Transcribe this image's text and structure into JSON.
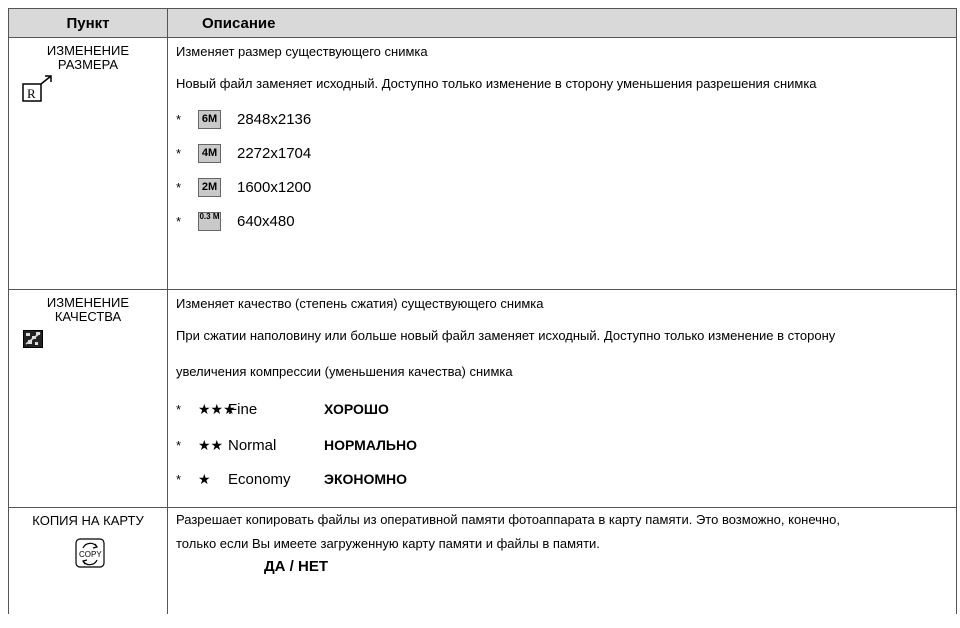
{
  "header": {
    "item": "Пункт",
    "description": "Описание"
  },
  "rows": [
    {
      "item": "ИЗМЕНЕНИЕ РАЗМЕРА",
      "lines": [
        "Изменяет размер существующего снимка",
        "Новый файл заменяет исходный. Доступно только изменение в сторону уменьшения разрешения снимка"
      ],
      "options": [
        {
          "bullet": "*",
          "badge": "6M",
          "value": "2848x2136"
        },
        {
          "bullet": "*",
          "badge": "4M",
          "value": "2272x1704"
        },
        {
          "bullet": "*",
          "badge": "2M",
          "value": "1600x1200"
        },
        {
          "bullet": "*",
          "badge": "0.3 M",
          "value": "640x480"
        }
      ]
    },
    {
      "item": "ИЗМЕНЕНИЕ КАЧЕСТВА",
      "lines": [
        "Изменяет качество (степень сжатия) существующего снимка",
        "При сжатии наполовину или больше новый файл заменяет исходный. Доступно только изменение в сторону",
        "увеличения компрессии (уменьшения качества) снимка"
      ],
      "options": [
        {
          "bullet": "*",
          "icon": "★★★",
          "name": "Fine",
          "label": "ХОРОШО"
        },
        {
          "bullet": "*",
          "icon": "★★",
          "name": "Normal",
          "label": "НОРМАЛЬНО"
        },
        {
          "bullet": "*",
          "icon": "★",
          "name": "Economy",
          "label": "ЭКОНОМНО"
        }
      ]
    },
    {
      "item": "КОПИЯ НА КАРТУ",
      "lines": [
        "Разрешает копировать файлы из оперативной памяти фотоаппарата в карту памяти. Это возможно, конечно,",
        "только если Вы имеете загруженную карту памяти и файлы в памяти."
      ],
      "choice": "ДА / НЕТ"
    }
  ]
}
